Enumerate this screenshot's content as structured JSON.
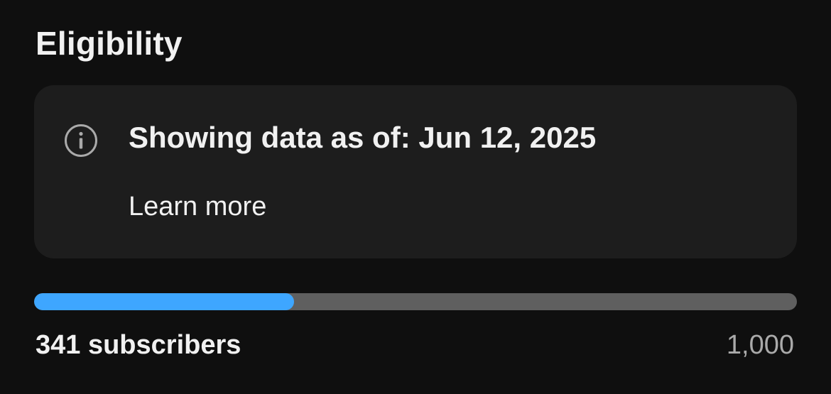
{
  "eligibility": {
    "title": "Eligibility",
    "info": {
      "icon": "info-icon",
      "headline": "Showing data as of: Jun 12, 2025",
      "link_label": "Learn more"
    },
    "progress": {
      "current_label": "341 subscribers",
      "goal_label": "1,000",
      "current": 341,
      "goal": 1000,
      "fill_color": "#3ea6ff",
      "track_color": "#5f5f5f"
    }
  }
}
